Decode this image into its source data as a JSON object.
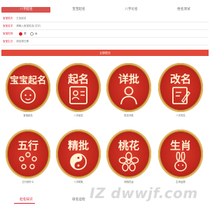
{
  "tabs": [
    {
      "label": "八字起名",
      "active": true
    },
    {
      "label": "宝宝起名",
      "active": false
    },
    {
      "label": "八字论名",
      "active": false
    },
    {
      "label": "姓名测试",
      "active": false
    }
  ],
  "form": {
    "surname": {
      "label": "宝宝姓氏",
      "value": "王加起名"
    },
    "fullname": {
      "label": "宝宝名字",
      "value": "请输入宝宝姓名(汉字)"
    },
    "gender": {
      "label": "宝宝性别",
      "options": [
        "男",
        "女"
      ],
      "selected": "男"
    },
    "birthday": {
      "label": "宝宝生日",
      "value": "请选择日期"
    },
    "submit_label": "立即提交"
  },
  "cards": [
    {
      "title": "宝宝起名",
      "caption": "宝宝起名",
      "icon": "baby-face-icon"
    },
    {
      "title": "起名",
      "caption": "八字起名",
      "icon": "id-card-icon"
    },
    {
      "title": "详批",
      "caption": "姓名详批",
      "icon": "person-icon"
    },
    {
      "title": "改名",
      "caption": "八字改名",
      "icon": "edit-document-icon"
    },
    {
      "title": "五行",
      "caption": "五行缺什么",
      "icon": "bead-ring-icon"
    },
    {
      "title": "精批",
      "caption": "八字精批",
      "icon": "yin-yang-icon"
    },
    {
      "title": "桃花",
      "caption": "测桃花运",
      "icon": "flower-icon"
    },
    {
      "title": "生肖",
      "caption": "生肖运势",
      "icon": "rabbit-icon"
    }
  ],
  "bottom_tabs": [
    {
      "label": "起名知识",
      "active": true
    },
    {
      "label": "取名运程",
      "active": false
    }
  ],
  "watermark": {
    "text": "IZ dwwjf.com"
  }
}
